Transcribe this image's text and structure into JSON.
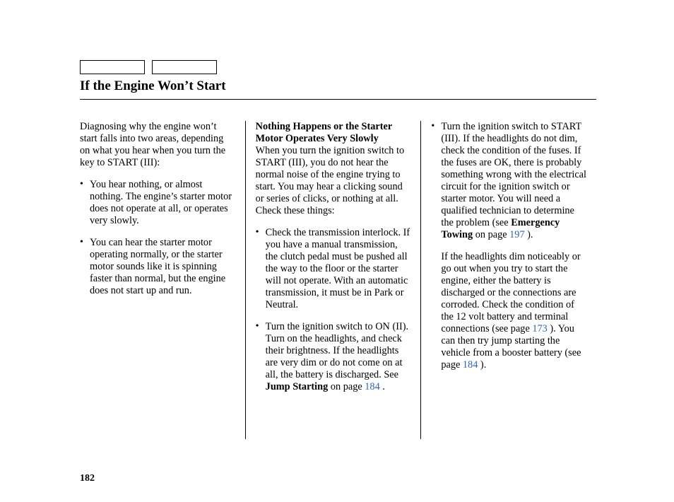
{
  "title": "If the Engine Won’t Start",
  "page_number": "182",
  "col1": {
    "intro": "Diagnosing why the engine won’t start falls into two areas, depending on what you hear when you turn the key to START (III):",
    "bullets": [
      "You hear nothing, or almost nothing. The engine’s starter motor does not operate at all, or operates very slowly.",
      "You can hear the starter motor operating normally, or the starter motor sounds like it is spinning faster than normal, but the engine does not start up and run."
    ]
  },
  "col2": {
    "subhead": "Nothing Happens or the Starter Motor Operates Very Slowly",
    "para1": "When you turn the ignition switch to START (III), you do not hear the normal noise of the engine trying to start. You may hear a clicking sound or series of clicks, or nothing at all. Check these things:",
    "bullets": [
      "Check the transmission interlock. If you have a manual transmission, the clutch pedal must be pushed all the way to the floor or the starter will not operate. With an automatic transmission, it must be in Park or Neutral."
    ],
    "bullet2_pre": "Turn the ignition switch to ON (II). Turn on the headlights, and check their brightness. If the headlights are very dim or do not come on at all, the battery is discharged. See ",
    "bullet2_bold": "Jump Starting",
    "bullet2_mid": " on page ",
    "bullet2_link": "184",
    "bullet2_post": " ."
  },
  "col3": {
    "bullet1_pre": "Turn the ignition switch to START (III). If the headlights do not dim, check the condition of the fuses. If the fuses are OK, there is probably something wrong with the electrical circuit for the ignition switch or starter motor. You will need a qualified technician to determine the problem (see ",
    "bullet1_bold": "Emergency Towing",
    "bullet1_mid": " on page ",
    "bullet1_link": "197",
    "bullet1_post": " ).",
    "follow_pre": "If the headlights dim noticeably or go out when you try to start the engine, either the battery is discharged or the connections are corroded. Check the condition of the 12 volt battery and terminal connections (see page ",
    "follow_link1": "173",
    "follow_mid": " ). You can then try jump starting the vehicle from a booster battery (see page ",
    "follow_link2": "184",
    "follow_post": " )."
  }
}
